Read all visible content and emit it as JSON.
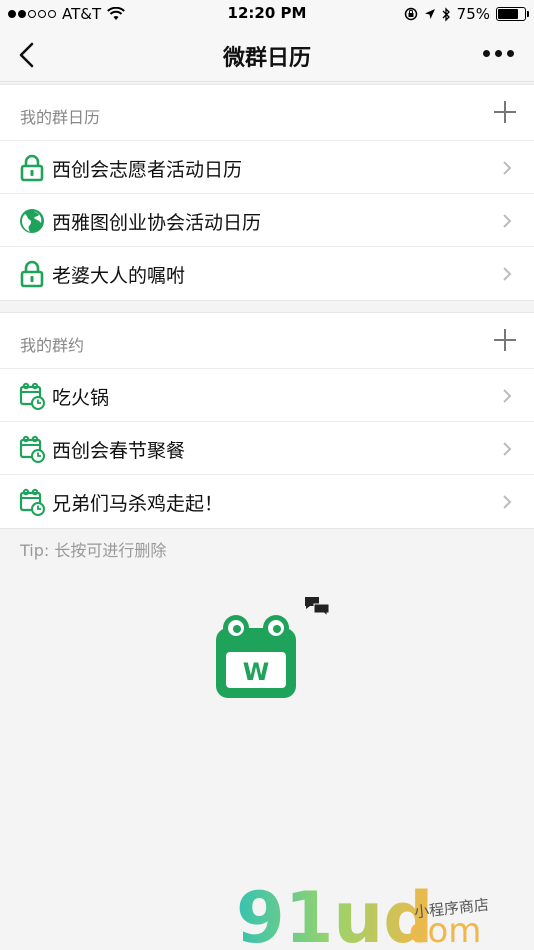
{
  "status_bar": {
    "carrier": "AT&T",
    "time": "12:20 PM",
    "battery_percent": "75%",
    "battery_level": 0.75,
    "signal_bars_filled": 2,
    "signal_bars_total": 5
  },
  "nav": {
    "title": "微群日历",
    "back_icon": "chevron-left-icon",
    "more_icon": "more-dots-icon"
  },
  "calendars": {
    "title": "我的群日历",
    "items": [
      {
        "label": "西创会志愿者活动日历",
        "icon": "lock-icon"
      },
      {
        "label": "西雅图创业协会活动日历",
        "icon": "globe-icon"
      },
      {
        "label": "老婆大人的嘱咐",
        "icon": "lock-icon"
      }
    ]
  },
  "appointments": {
    "title": "我的群约",
    "items": [
      {
        "label": "吃火锅",
        "icon": "calendar-clock-icon"
      },
      {
        "label": "西创会春节聚餐",
        "icon": "calendar-clock-icon"
      },
      {
        "label": "兄弟们马杀鸡走起！",
        "icon": "calendar-clock-icon"
      }
    ]
  },
  "tip": "Tip: 长按可进行删除",
  "logo_letter": "W",
  "watermark": {
    "brand": "91ud",
    "suffix": ".com",
    "tagline": "小程序商店"
  },
  "colors": {
    "accent": "#1fa25a",
    "background": "#f4f4f4",
    "text": "#111111",
    "muted": "#888888"
  }
}
